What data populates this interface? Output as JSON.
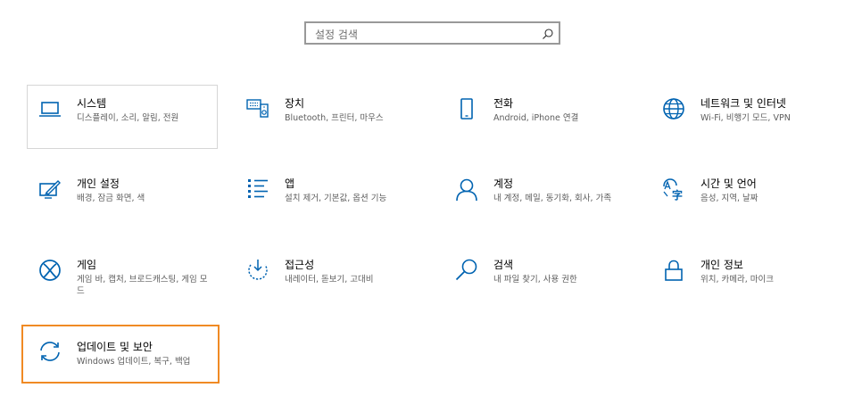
{
  "search": {
    "placeholder": "설정 검색",
    "icon": "search-icon"
  },
  "tiles": [
    {
      "title": "시스템",
      "desc": "디스플레이, 소리, 알림, 전원",
      "icon": "laptop-icon"
    },
    {
      "title": "장치",
      "desc": "Bluetooth, 프린터, 마우스",
      "icon": "devices-icon"
    },
    {
      "title": "전화",
      "desc": "Android, iPhone 연결",
      "icon": "phone-icon"
    },
    {
      "title": "네트워크 및 인터넷",
      "desc": "Wi-Fi, 비행기 모드, VPN",
      "icon": "globe-icon"
    },
    {
      "title": "개인 설정",
      "desc": "배경, 잠금 화면, 색",
      "icon": "personalization-icon"
    },
    {
      "title": "앱",
      "desc": "설치 제거, 기본값, 옵션 기능",
      "icon": "apps-list-icon"
    },
    {
      "title": "계정",
      "desc": "내 계정, 메일, 동기화, 회사, 가족",
      "icon": "person-icon"
    },
    {
      "title": "시간 및 언어",
      "desc": "음성, 지역, 날짜",
      "icon": "time-language-icon"
    },
    {
      "title": "게임",
      "desc": "게임 바, 캡처, 브로드캐스팅, 게임 모드",
      "icon": "xbox-icon"
    },
    {
      "title": "접근성",
      "desc": "내레이터, 돋보기, 고대비",
      "icon": "ease-of-access-icon"
    },
    {
      "title": "검색",
      "desc": "내 파일 찾기, 사용 권한",
      "icon": "search-icon"
    },
    {
      "title": "개인 정보",
      "desc": "위치, 카메라, 마이크",
      "icon": "lock-icon"
    },
    {
      "title": "업데이트 및 보안",
      "desc": "Windows 업데이트, 복구, 백업",
      "icon": "sync-icon"
    }
  ],
  "colors": {
    "accent": "#0063b1",
    "selected_border": "#f08a24",
    "hover_border": "#d6d6d6",
    "search_border": "#999999"
  }
}
